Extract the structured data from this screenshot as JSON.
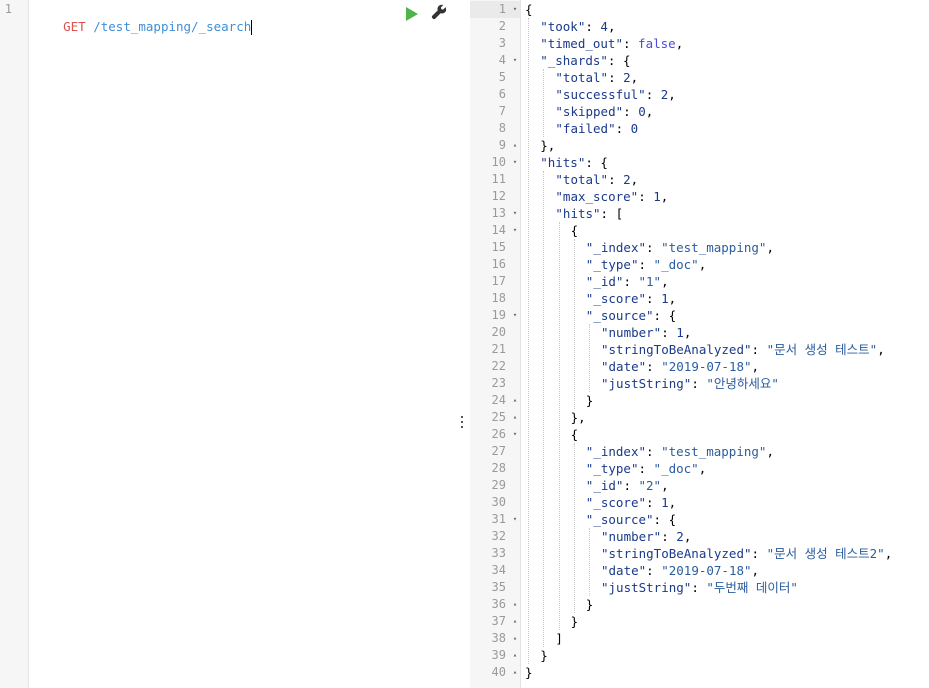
{
  "request": {
    "line_number": "1",
    "method": "GET",
    "path": "/test_mapping/_search"
  },
  "toolbar": {
    "run_icon": "play-icon",
    "settings_icon": "wrench-icon"
  },
  "response": {
    "lines": [
      {
        "n": "1",
        "fold": "▾",
        "indent": 0,
        "tokens": [
          [
            "punc",
            "{"
          ]
        ]
      },
      {
        "n": "2",
        "fold": "",
        "indent": 1,
        "tokens": [
          [
            "key",
            "\"took\""
          ],
          [
            "punc",
            ": "
          ],
          [
            "num",
            "4"
          ],
          [
            "punc",
            ","
          ]
        ]
      },
      {
        "n": "3",
        "fold": "",
        "indent": 1,
        "tokens": [
          [
            "key",
            "\"timed_out\""
          ],
          [
            "punc",
            ": "
          ],
          [
            "bool",
            "false"
          ],
          [
            "punc",
            ","
          ]
        ]
      },
      {
        "n": "4",
        "fold": "▾",
        "indent": 1,
        "tokens": [
          [
            "key",
            "\"_shards\""
          ],
          [
            "punc",
            ": {"
          ]
        ]
      },
      {
        "n": "5",
        "fold": "",
        "indent": 2,
        "tokens": [
          [
            "key",
            "\"total\""
          ],
          [
            "punc",
            ": "
          ],
          [
            "num",
            "2"
          ],
          [
            "punc",
            ","
          ]
        ]
      },
      {
        "n": "6",
        "fold": "",
        "indent": 2,
        "tokens": [
          [
            "key",
            "\"successful\""
          ],
          [
            "punc",
            ": "
          ],
          [
            "num",
            "2"
          ],
          [
            "punc",
            ","
          ]
        ]
      },
      {
        "n": "7",
        "fold": "",
        "indent": 2,
        "tokens": [
          [
            "key",
            "\"skipped\""
          ],
          [
            "punc",
            ": "
          ],
          [
            "num",
            "0"
          ],
          [
            "punc",
            ","
          ]
        ]
      },
      {
        "n": "8",
        "fold": "",
        "indent": 2,
        "tokens": [
          [
            "key",
            "\"failed\""
          ],
          [
            "punc",
            ": "
          ],
          [
            "num",
            "0"
          ]
        ]
      },
      {
        "n": "9",
        "fold": "▴",
        "indent": 1,
        "tokens": [
          [
            "punc",
            "},"
          ]
        ]
      },
      {
        "n": "10",
        "fold": "▾",
        "indent": 1,
        "tokens": [
          [
            "key",
            "\"hits\""
          ],
          [
            "punc",
            ": {"
          ]
        ]
      },
      {
        "n": "11",
        "fold": "",
        "indent": 2,
        "tokens": [
          [
            "key",
            "\"total\""
          ],
          [
            "punc",
            ": "
          ],
          [
            "num",
            "2"
          ],
          [
            "punc",
            ","
          ]
        ]
      },
      {
        "n": "12",
        "fold": "",
        "indent": 2,
        "tokens": [
          [
            "key",
            "\"max_score\""
          ],
          [
            "punc",
            ": "
          ],
          [
            "num",
            "1"
          ],
          [
            "punc",
            ","
          ]
        ]
      },
      {
        "n": "13",
        "fold": "▾",
        "indent": 2,
        "tokens": [
          [
            "key",
            "\"hits\""
          ],
          [
            "punc",
            ": ["
          ]
        ]
      },
      {
        "n": "14",
        "fold": "▾",
        "indent": 3,
        "tokens": [
          [
            "punc",
            "{"
          ]
        ]
      },
      {
        "n": "15",
        "fold": "",
        "indent": 4,
        "tokens": [
          [
            "key",
            "\"_index\""
          ],
          [
            "punc",
            ": "
          ],
          [
            "str",
            "\"test_mapping\""
          ],
          [
            "punc",
            ","
          ]
        ]
      },
      {
        "n": "16",
        "fold": "",
        "indent": 4,
        "tokens": [
          [
            "key",
            "\"_type\""
          ],
          [
            "punc",
            ": "
          ],
          [
            "str",
            "\"_doc\""
          ],
          [
            "punc",
            ","
          ]
        ]
      },
      {
        "n": "17",
        "fold": "",
        "indent": 4,
        "tokens": [
          [
            "key",
            "\"_id\""
          ],
          [
            "punc",
            ": "
          ],
          [
            "str",
            "\"1\""
          ],
          [
            "punc",
            ","
          ]
        ]
      },
      {
        "n": "18",
        "fold": "",
        "indent": 4,
        "tokens": [
          [
            "key",
            "\"_score\""
          ],
          [
            "punc",
            ": "
          ],
          [
            "num",
            "1"
          ],
          [
            "punc",
            ","
          ]
        ]
      },
      {
        "n": "19",
        "fold": "▾",
        "indent": 4,
        "tokens": [
          [
            "key",
            "\"_source\""
          ],
          [
            "punc",
            ": {"
          ]
        ]
      },
      {
        "n": "20",
        "fold": "",
        "indent": 5,
        "tokens": [
          [
            "key",
            "\"number\""
          ],
          [
            "punc",
            ": "
          ],
          [
            "num",
            "1"
          ],
          [
            "punc",
            ","
          ]
        ]
      },
      {
        "n": "21",
        "fold": "",
        "indent": 5,
        "tokens": [
          [
            "key",
            "\"stringToBeAnalyzed\""
          ],
          [
            "punc",
            ": "
          ],
          [
            "str",
            "\"문서 생성 테스트\""
          ],
          [
            "punc",
            ","
          ]
        ]
      },
      {
        "n": "22",
        "fold": "",
        "indent": 5,
        "tokens": [
          [
            "key",
            "\"date\""
          ],
          [
            "punc",
            ": "
          ],
          [
            "str",
            "\"2019-07-18\""
          ],
          [
            "punc",
            ","
          ]
        ]
      },
      {
        "n": "23",
        "fold": "",
        "indent": 5,
        "tokens": [
          [
            "key",
            "\"justString\""
          ],
          [
            "punc",
            ": "
          ],
          [
            "str",
            "\"안녕하세요\""
          ]
        ]
      },
      {
        "n": "24",
        "fold": "▴",
        "indent": 4,
        "tokens": [
          [
            "punc",
            "}"
          ]
        ]
      },
      {
        "n": "25",
        "fold": "▴",
        "indent": 3,
        "tokens": [
          [
            "punc",
            "},"
          ]
        ]
      },
      {
        "n": "26",
        "fold": "▾",
        "indent": 3,
        "tokens": [
          [
            "punc",
            "{"
          ]
        ]
      },
      {
        "n": "27",
        "fold": "",
        "indent": 4,
        "tokens": [
          [
            "key",
            "\"_index\""
          ],
          [
            "punc",
            ": "
          ],
          [
            "str",
            "\"test_mapping\""
          ],
          [
            "punc",
            ","
          ]
        ]
      },
      {
        "n": "28",
        "fold": "",
        "indent": 4,
        "tokens": [
          [
            "key",
            "\"_type\""
          ],
          [
            "punc",
            ": "
          ],
          [
            "str",
            "\"_doc\""
          ],
          [
            "punc",
            ","
          ]
        ]
      },
      {
        "n": "29",
        "fold": "",
        "indent": 4,
        "tokens": [
          [
            "key",
            "\"_id\""
          ],
          [
            "punc",
            ": "
          ],
          [
            "str",
            "\"2\""
          ],
          [
            "punc",
            ","
          ]
        ]
      },
      {
        "n": "30",
        "fold": "",
        "indent": 4,
        "tokens": [
          [
            "key",
            "\"_score\""
          ],
          [
            "punc",
            ": "
          ],
          [
            "num",
            "1"
          ],
          [
            "punc",
            ","
          ]
        ]
      },
      {
        "n": "31",
        "fold": "▾",
        "indent": 4,
        "tokens": [
          [
            "key",
            "\"_source\""
          ],
          [
            "punc",
            ": {"
          ]
        ]
      },
      {
        "n": "32",
        "fold": "",
        "indent": 5,
        "tokens": [
          [
            "key",
            "\"number\""
          ],
          [
            "punc",
            ": "
          ],
          [
            "num",
            "2"
          ],
          [
            "punc",
            ","
          ]
        ]
      },
      {
        "n": "33",
        "fold": "",
        "indent": 5,
        "tokens": [
          [
            "key",
            "\"stringToBeAnalyzed\""
          ],
          [
            "punc",
            ": "
          ],
          [
            "str",
            "\"문서 생성 테스트2\""
          ],
          [
            "punc",
            ","
          ]
        ]
      },
      {
        "n": "34",
        "fold": "",
        "indent": 5,
        "tokens": [
          [
            "key",
            "\"date\""
          ],
          [
            "punc",
            ": "
          ],
          [
            "str",
            "\"2019-07-18\""
          ],
          [
            "punc",
            ","
          ]
        ]
      },
      {
        "n": "35",
        "fold": "",
        "indent": 5,
        "tokens": [
          [
            "key",
            "\"justString\""
          ],
          [
            "punc",
            ": "
          ],
          [
            "str",
            "\"두번째 데이터\""
          ]
        ]
      },
      {
        "n": "36",
        "fold": "▴",
        "indent": 4,
        "tokens": [
          [
            "punc",
            "}"
          ]
        ]
      },
      {
        "n": "37",
        "fold": "▴",
        "indent": 3,
        "tokens": [
          [
            "punc",
            "}"
          ]
        ]
      },
      {
        "n": "38",
        "fold": "▴",
        "indent": 2,
        "tokens": [
          [
            "punc",
            "]"
          ]
        ]
      },
      {
        "n": "39",
        "fold": "▴",
        "indent": 1,
        "tokens": [
          [
            "punc",
            "}"
          ]
        ]
      },
      {
        "n": "40",
        "fold": "▴",
        "indent": 0,
        "tokens": [
          [
            "punc",
            "}"
          ]
        ]
      }
    ]
  }
}
